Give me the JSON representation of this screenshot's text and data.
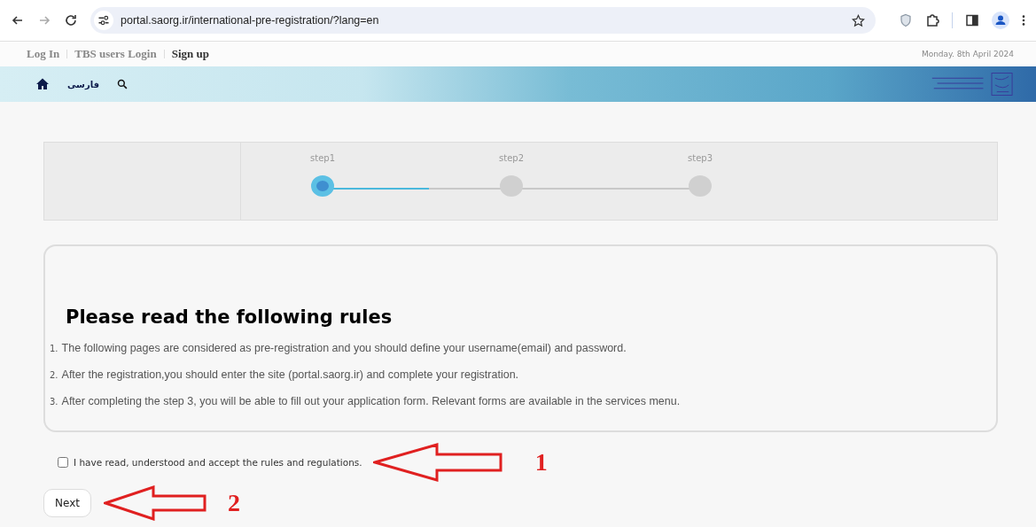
{
  "browser": {
    "url": "portal.saorg.ir/international-pre-registration/?lang=en",
    "forward_disabled": true
  },
  "top_links": [
    {
      "label": "Log In",
      "selected": false
    },
    {
      "label": "TBS users Login",
      "selected": false
    },
    {
      "label": "Sign up",
      "selected": true
    }
  ],
  "date": "Monday. 8th April 2024",
  "nav": {
    "language": "فارسی"
  },
  "stepper": {
    "level": 0.28,
    "steps": [
      {
        "label": "step1",
        "selected": true
      },
      {
        "label": "step2",
        "selected": false
      },
      {
        "label": "step3",
        "selected": false
      }
    ]
  },
  "rules": {
    "title": "Please read the following rules",
    "items": [
      {
        "number": "1.",
        "text": "The following pages are considered as pre-registration and you should define your username(email) and password."
      },
      {
        "number": "2.",
        "text": "After the registration,you should enter the site (portal.saorg.ir) and complete your registration."
      },
      {
        "number": "3.",
        "text": "After completing the step 3, you will be able to fill out your application form. Relevant forms are available in the services menu."
      }
    ]
  },
  "agreement": {
    "label": "I have read, understood and accept the rules and regulations.",
    "checked": false
  },
  "next_button": "Next",
  "annotations": [
    "1",
    "2"
  ]
}
